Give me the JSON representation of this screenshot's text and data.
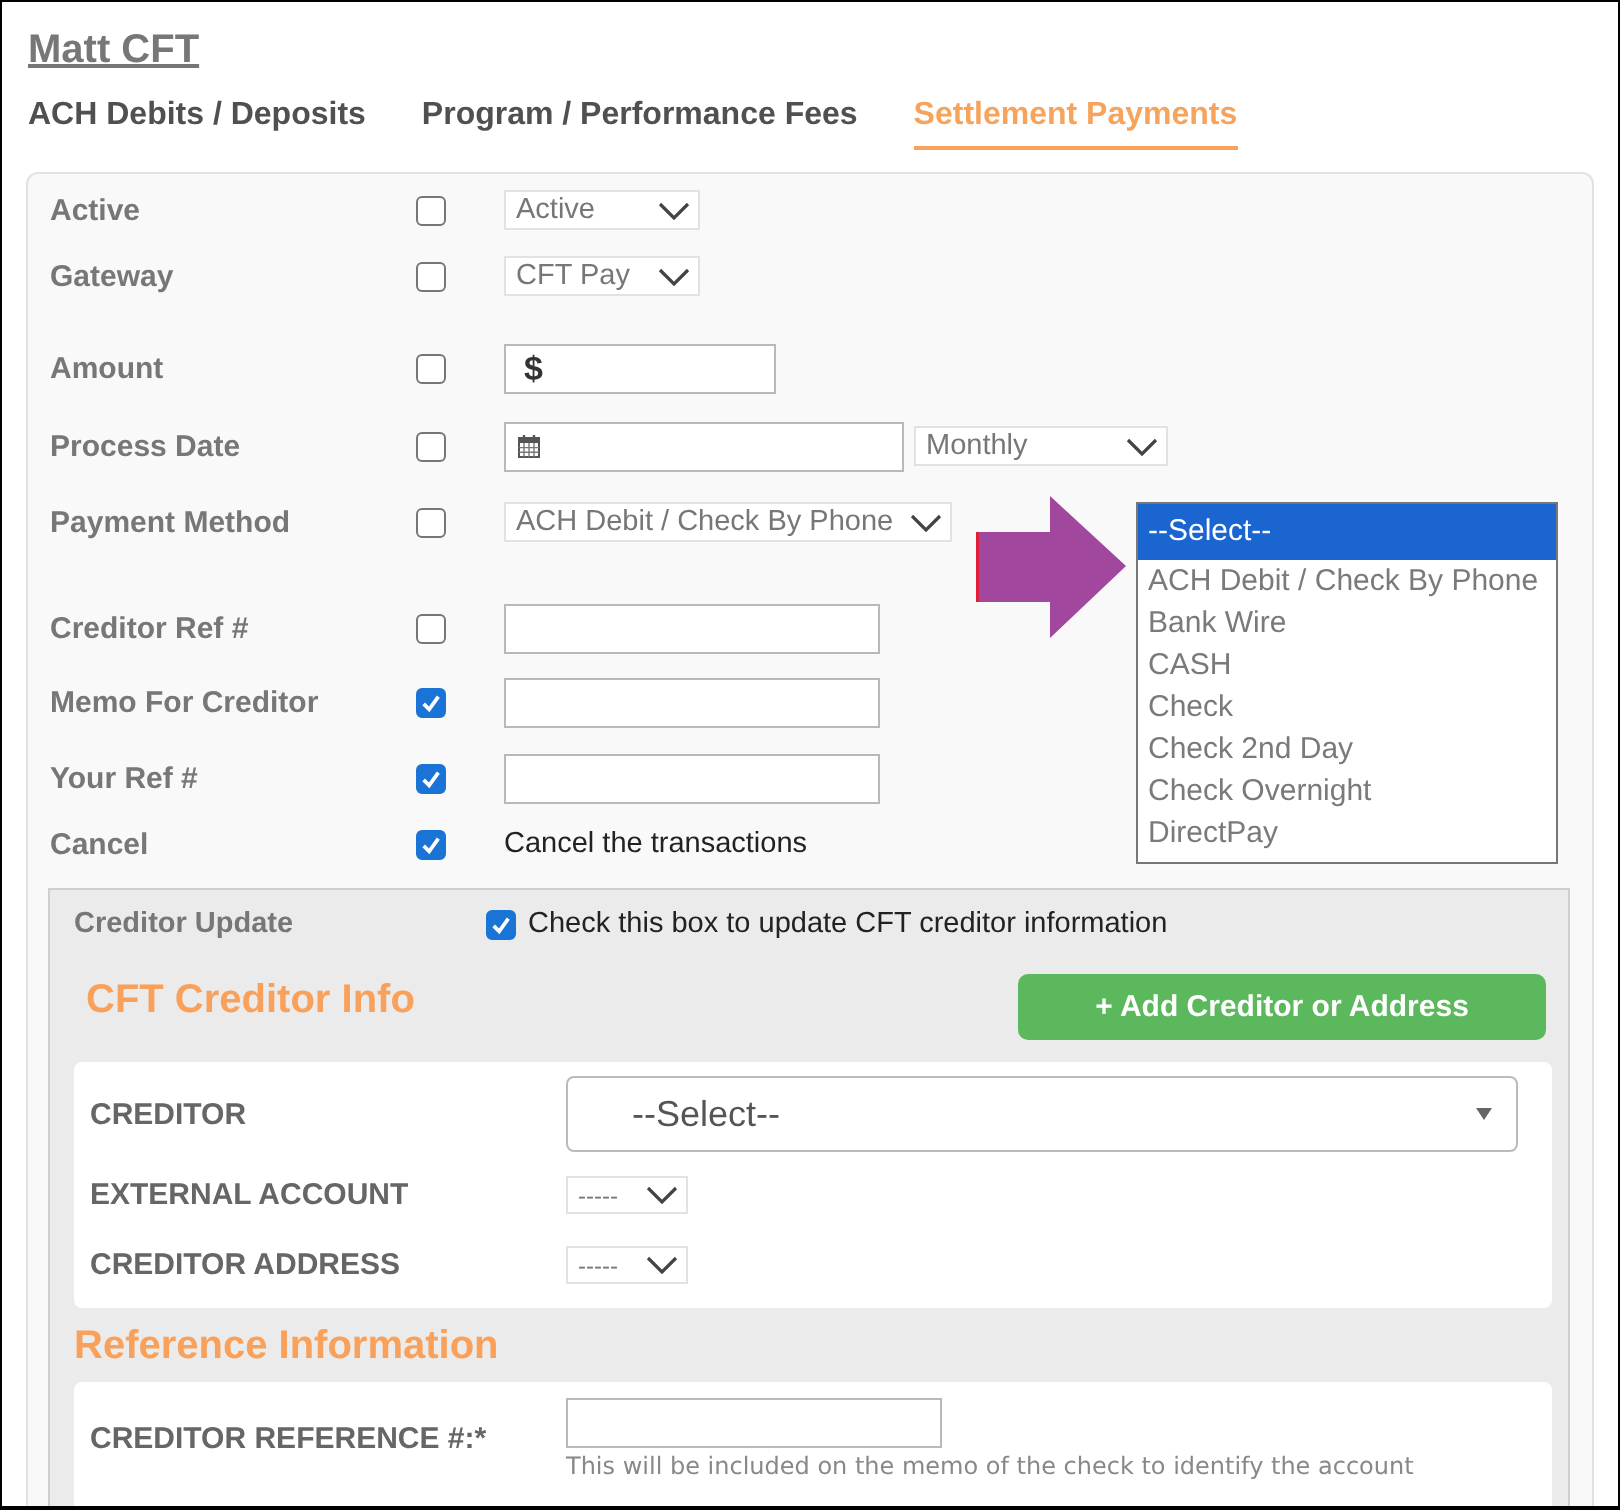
{
  "page": {
    "title": "Matt CFT"
  },
  "tabs": [
    {
      "label": "ACH Debits / Deposits",
      "selected": false
    },
    {
      "label": "Program / Performance Fees",
      "selected": false
    },
    {
      "label": "Settlement Payments",
      "selected": true
    }
  ],
  "fields": [
    {
      "label": "Active",
      "checked": false,
      "kind": "select",
      "value": "Active"
    },
    {
      "label": "Gateway",
      "checked": false,
      "kind": "select",
      "value": "CFT Pay"
    },
    {
      "label": "Amount",
      "checked": false,
      "kind": "currency",
      "prefix": "$"
    },
    {
      "label": "Process Date",
      "checked": false,
      "kind": "date",
      "frequency": "Monthly"
    },
    {
      "label": "Payment Method",
      "checked": false,
      "kind": "select",
      "value": "ACH Debit / Check By Phone"
    },
    {
      "label": "Creditor Ref #",
      "checked": false,
      "kind": "text"
    },
    {
      "label": "Memo For Creditor",
      "checked": true,
      "kind": "text"
    },
    {
      "label": "Your Ref #",
      "checked": true,
      "kind": "text"
    },
    {
      "label": "Cancel",
      "checked": true,
      "kind": "note",
      "text": "Cancel the transactions"
    }
  ],
  "payment_method_dropdown": {
    "options": [
      {
        "label": "--Select--",
        "selected": true
      },
      {
        "label": "ACH Debit / Check By Phone",
        "selected": false
      },
      {
        "label": "Bank Wire",
        "selected": false
      },
      {
        "label": "CASH",
        "selected": false
      },
      {
        "label": "Check",
        "selected": false
      },
      {
        "label": "Check 2nd Day",
        "selected": false
      },
      {
        "label": "Check Overnight",
        "selected": false
      },
      {
        "label": "DirectPay",
        "selected": false
      }
    ]
  },
  "creditor_update": {
    "label": "Creditor Update",
    "checked": true,
    "text": "Check this box to update CFT creditor information",
    "section_title": "CFT Creditor Info",
    "add_button": "+ Add Creditor or Address",
    "fields": [
      {
        "label": "CREDITOR",
        "kind": "combo",
        "value": "--Select--"
      },
      {
        "label": "EXTERNAL ACCOUNT",
        "kind": "select",
        "value": "-----"
      },
      {
        "label": "CREDITOR ADDRESS",
        "kind": "select",
        "value": "-----"
      }
    ]
  },
  "reference_information": {
    "title": "Reference Information",
    "fields": [
      {
        "label": "CREDITOR REFERENCE #:*",
        "hint": "This will be included on the memo of the check to identify the account"
      }
    ]
  }
}
